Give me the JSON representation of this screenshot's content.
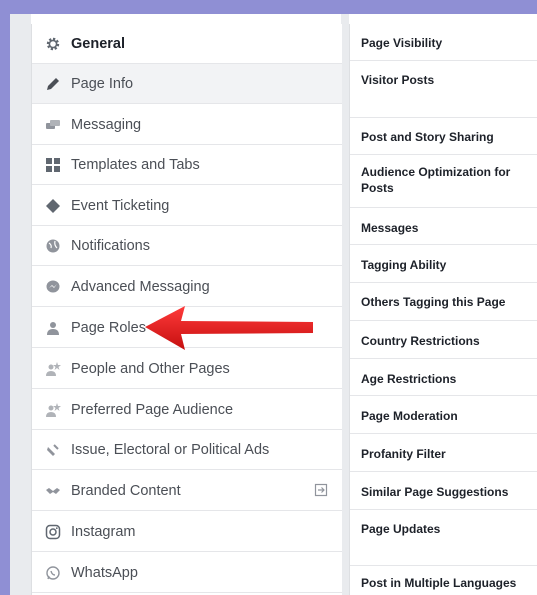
{
  "left_nav": {
    "items": [
      {
        "label": "General",
        "icon": "gear-icon"
      },
      {
        "label": "Page Info",
        "icon": "pencil-icon"
      },
      {
        "label": "Messaging",
        "icon": "chat-bubbles-icon"
      },
      {
        "label": "Templates and Tabs",
        "icon": "grid-icon"
      },
      {
        "label": "Event Ticketing",
        "icon": "ticket-tag-icon"
      },
      {
        "label": "Notifications",
        "icon": "globe-icon"
      },
      {
        "label": "Advanced Messaging",
        "icon": "messenger-icon"
      },
      {
        "label": "Page Roles",
        "icon": "person-icon"
      },
      {
        "label": "People and Other Pages",
        "icon": "people-star-icon"
      },
      {
        "label": "Preferred Page Audience",
        "icon": "people-star-icon"
      },
      {
        "label": "Issue, Electoral or Political Ads",
        "icon": "megaphone-icon"
      },
      {
        "label": "Branded Content",
        "icon": "handshake-icon"
      },
      {
        "label": "Instagram",
        "icon": "instagram-icon"
      },
      {
        "label": "WhatsApp",
        "icon": "whatsapp-icon"
      }
    ],
    "branded_content_trailing_icon": "external-link-icon"
  },
  "settings": {
    "rows": [
      {
        "label": "Page Visibility"
      },
      {
        "label": "Visitor Posts"
      },
      {
        "label": "Post and Story Sharing"
      },
      {
        "label": "Audience Optimization for Posts"
      },
      {
        "label": "Messages"
      },
      {
        "label": "Tagging Ability"
      },
      {
        "label": "Others Tagging this Page"
      },
      {
        "label": "Country Restrictions"
      },
      {
        "label": "Age Restrictions"
      },
      {
        "label": "Page Moderation"
      },
      {
        "label": "Profanity Filter"
      },
      {
        "label": "Similar Page Suggestions"
      },
      {
        "label": "Page Updates"
      },
      {
        "label": "Post in Multiple Languages"
      }
    ]
  },
  "colors": {
    "frame": "#8f8fd4",
    "arrow": "#e31818",
    "icon_gray": "#90949c",
    "hover_background": "#f2f3f5"
  }
}
